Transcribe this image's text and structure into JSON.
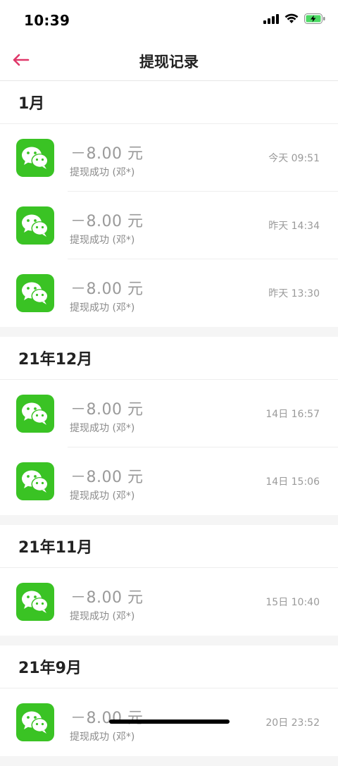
{
  "status_bar": {
    "time": "10:39",
    "icons": [
      "signal-icon",
      "wifi-icon",
      "battery-charging-icon"
    ]
  },
  "nav": {
    "title": "提现记录",
    "back_icon": "back-arrow-icon",
    "accent_color": "#e0386a"
  },
  "sections": [
    {
      "month": "1月",
      "records": [
        {
          "amount": "－8.00 元",
          "desc": "提现成功 (邓*)",
          "time": "今天 09:51"
        },
        {
          "amount": "－8.00 元",
          "desc": "提现成功 (邓*)",
          "time": "昨天 14:34"
        },
        {
          "amount": "－8.00 元",
          "desc": "提现成功 (邓*)",
          "time": "昨天 13:30"
        }
      ]
    },
    {
      "month": "21年12月",
      "records": [
        {
          "amount": "－8.00 元",
          "desc": "提现成功 (邓*)",
          "time": "14日 16:57"
        },
        {
          "amount": "－8.00 元",
          "desc": "提现成功 (邓*)",
          "time": "14日 15:06"
        }
      ]
    },
    {
      "month": "21年11月",
      "records": [
        {
          "amount": "－8.00 元",
          "desc": "提现成功 (邓*)",
          "time": "15日 10:40"
        }
      ]
    },
    {
      "month": "21年9月",
      "records": [
        {
          "amount": "－8.00 元",
          "desc": "提现成功 (邓*)",
          "time": "20日 23:52"
        }
      ]
    }
  ],
  "colors": {
    "wechat_green": "#3ac324",
    "battery_green": "#4cd964"
  }
}
